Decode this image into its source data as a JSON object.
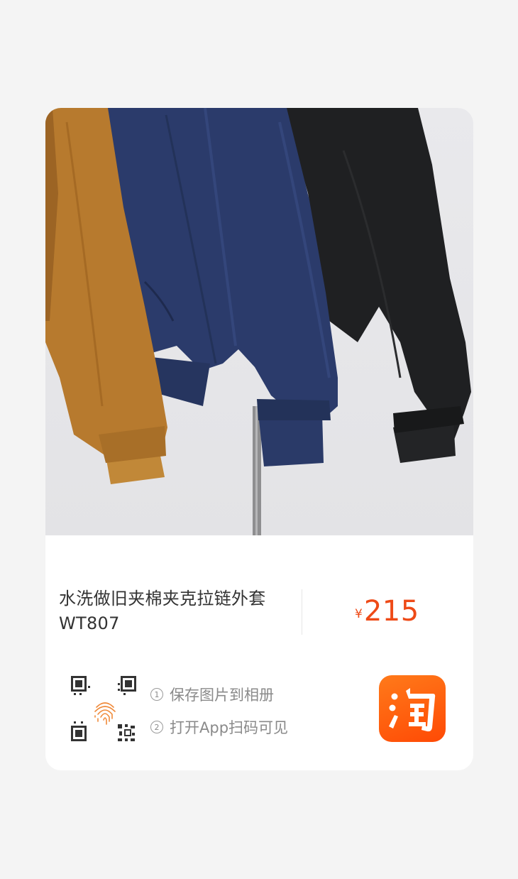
{
  "product": {
    "title": "水洗做旧夹棉夹克拉链外套WT807",
    "currency": "¥",
    "price": "215",
    "image_subject": "jackets-on-rack"
  },
  "share": {
    "steps": [
      {
        "num": "1",
        "label": "保存图片到相册"
      },
      {
        "num": "2",
        "label": "打开App扫码可见"
      }
    ],
    "logo_char": "淘",
    "icons": {
      "qr": "qr-code-icon",
      "fingerprint": "fingerprint-icon"
    }
  },
  "colors": {
    "price": "#ee4a17",
    "logo_bg": "#ff5a0a",
    "background": "#f4f4f4",
    "card": "#ffffff"
  }
}
